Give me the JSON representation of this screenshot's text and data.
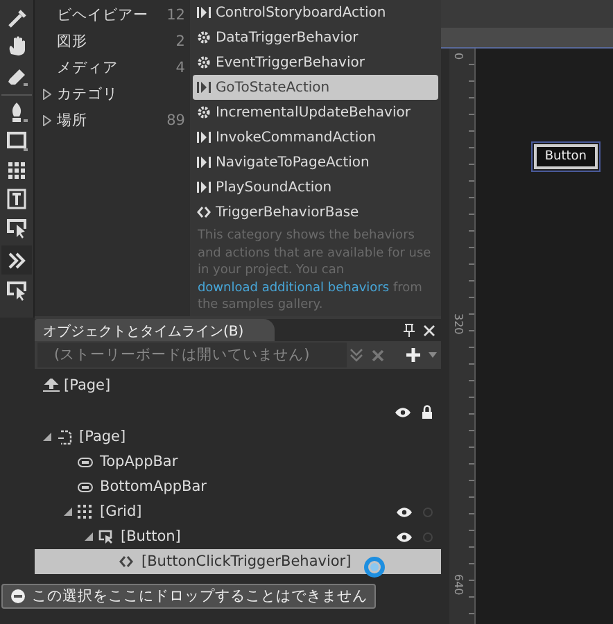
{
  "categories": [
    {
      "name": "ビヘイビアー",
      "count": "12",
      "kind": "leaf"
    },
    {
      "name": "図形",
      "count": "2",
      "kind": "leaf"
    },
    {
      "name": "メディア",
      "count": "4",
      "kind": "leaf"
    },
    {
      "name": "カテゴリ",
      "kind": "group"
    },
    {
      "name": "場所",
      "count": "89",
      "kind": "group"
    }
  ],
  "behaviors": [
    {
      "name": "ControlStoryboardAction",
      "kind": "action",
      "selected": false
    },
    {
      "name": "DataTriggerBehavior",
      "kind": "behavior",
      "selected": false
    },
    {
      "name": "EventTriggerBehavior",
      "kind": "behavior",
      "selected": false
    },
    {
      "name": "GoToStateAction",
      "kind": "action",
      "selected": true
    },
    {
      "name": "IncrementalUpdateBehavior",
      "kind": "behavior",
      "selected": false
    },
    {
      "name": "InvokeCommandAction",
      "kind": "action",
      "selected": false
    },
    {
      "name": "NavigateToPageAction",
      "kind": "action",
      "selected": false
    },
    {
      "name": "PlaySoundAction",
      "kind": "action",
      "selected": false
    },
    {
      "name": "TriggerBehaviorBase",
      "kind": "base",
      "selected": false
    }
  ],
  "description": {
    "before": "This category shows the behaviors and actions that are available for use in your project. You can ",
    "link": "download additional behaviors",
    "after": " from the samples gallery."
  },
  "objects_panel": {
    "title": "オブジェクトとタイムライン(B)",
    "storyboard": "(ストーリーボードは開いていません)",
    "scope": "[Page]",
    "tree": [
      {
        "name": "[Page]",
        "kind": "page",
        "expanded": true,
        "visibility_toggle": false,
        "selected": false,
        "children": [
          {
            "name": "TopAppBar",
            "kind": "appbar",
            "visibility_toggle": false,
            "selected": false
          },
          {
            "name": "BottomAppBar",
            "kind": "appbar",
            "visibility_toggle": false,
            "selected": false
          },
          {
            "name": "[Grid]",
            "kind": "grid",
            "expanded": true,
            "visibility_toggle": true,
            "selected": false,
            "children": [
              {
                "name": "[Button]",
                "kind": "button",
                "expanded": true,
                "visibility_toggle": true,
                "selected": false,
                "children": [
                  {
                    "name": "[ButtonClickTriggerBehavior]",
                    "kind": "behavior",
                    "visibility_toggle": false,
                    "selected": true
                  }
                ]
              }
            ]
          }
        ]
      }
    ]
  },
  "drop_tooltip": "この選択をここにドロップすることはできません",
  "ruler": [
    "0",
    "320",
    "640"
  ],
  "canvas": {
    "button_label": "Button"
  }
}
